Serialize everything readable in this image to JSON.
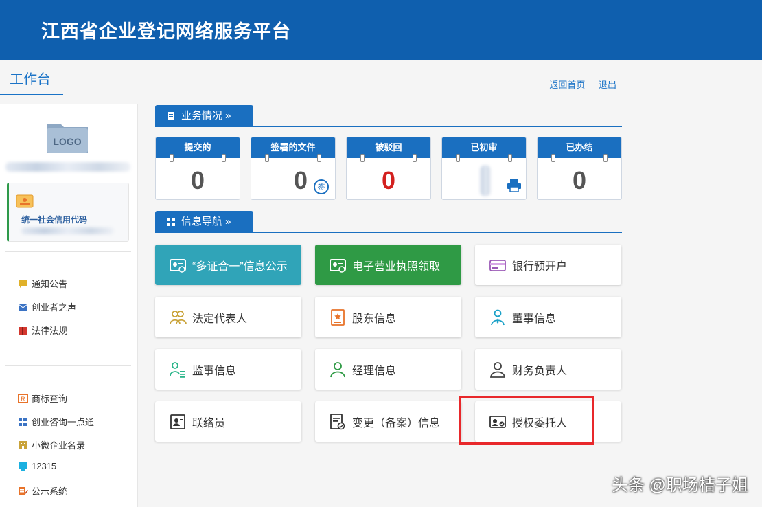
{
  "header": {
    "title": "江西省企业登记网络服务平台"
  },
  "workbar": {
    "tab": "工作台",
    "links": [
      "返回首页",
      "退出"
    ]
  },
  "sidebar": {
    "logo_text": "LOGO",
    "code_label": "统一社会信用代码",
    "group1": [
      "通知公告",
      "创业者之声",
      "法律法规"
    ],
    "group2": [
      "商标查询",
      "创业咨询一点通",
      "小微企业名录",
      "12315",
      "公示系统"
    ]
  },
  "business": {
    "title": "业务情况 »",
    "stats": [
      {
        "label": "提交的",
        "value": "0"
      },
      {
        "label": "签署的文件",
        "value": "0"
      },
      {
        "label": "被驳回",
        "value": "0"
      },
      {
        "label": "已初审",
        "value": ""
      },
      {
        "label": "已办结",
        "value": "0"
      }
    ],
    "sign_icon_text": "签"
  },
  "nav": {
    "title": "信息导航 »",
    "buttons": [
      "“多证合一”信息公示",
      "电子营业执照领取",
      "银行预开户",
      "法定代表人",
      "股东信息",
      "董事信息",
      "监事信息",
      "经理信息",
      "财务负责人",
      "联络员",
      "变更（备案）信息",
      "授权委托人"
    ]
  },
  "colors": {
    "header": "#0f5fae",
    "accent": "#1a6fc0",
    "teal": "#30a4b8",
    "green": "#2f9a45",
    "red": "#d3211f",
    "highlight": "#e8282b"
  },
  "watermark": "头条 @职场桔子姐"
}
